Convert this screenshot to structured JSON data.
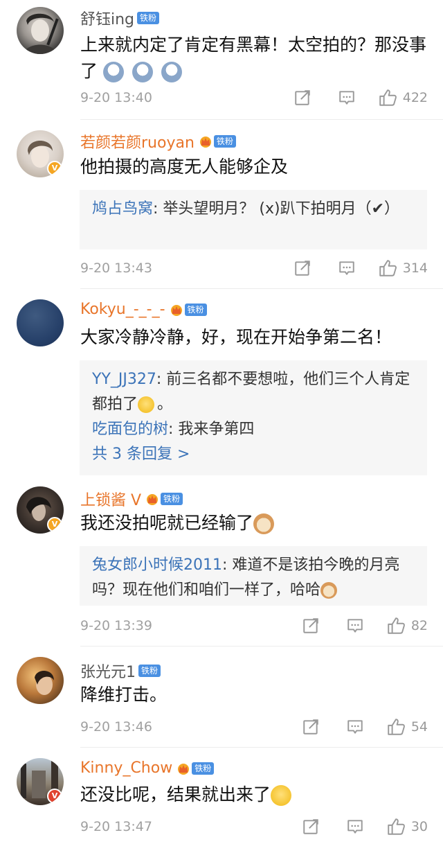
{
  "comments": [
    {
      "name": "舒钰ing",
      "badge": "铁粉",
      "text": "上来就内定了肯定有黑幕！太空拍的？那没事了",
      "time": "9-20 13:40",
      "likes": "422"
    },
    {
      "name": "若颜若颜ruoyan",
      "badge": "铁粉",
      "text": "他拍摄的高度无人能够企及",
      "reply_user": "鸠占鸟窝",
      "reply_text": "举头望明月？ (x)趴下拍明月（✔）",
      "time": "9-20 13:43",
      "likes": "314"
    },
    {
      "name": "Kokyu_-_-_-",
      "badge": "铁粉",
      "text": "大家冷静冷静，好，现在开始争第二名！",
      "reply1_user": "YY_JJ327",
      "reply1_text": "前三名都不要想啦，他们三个人肯定都拍了",
      "reply1_end": "。",
      "reply2_user": "吃面包的树",
      "reply2_text": "我来争第四",
      "more_replies": "共 3 条回复 >"
    },
    {
      "name": "上锁酱 V",
      "badge": "铁粉",
      "text": "我还没拍呢就已经输了",
      "reply_user": "兔女郎小时候2011",
      "reply_text": "难道不是该拍今晚的月亮吗？现在他们和咱们一样了，哈哈",
      "time": "9-20 13:39",
      "likes": "82"
    },
    {
      "name": "张光元1",
      "badge": "铁粉",
      "text": "降维打击。",
      "time": "9-20 13:46",
      "likes": "54"
    },
    {
      "name": "Kinny_Chow",
      "badge": "铁粉",
      "text": "还没比呢，结果就出来了",
      "time": "9-20 13:47",
      "likes": "30"
    }
  ],
  "colors": {
    "name_gray": "#555555",
    "name_vip": "#e8752a",
    "link_blue": "#3b73b8",
    "badge_blue": "#4a90e2",
    "meta_gray": "#a0a0a0",
    "reply_bg": "#f6f6f6"
  },
  "icons": [
    "share-icon",
    "comment-icon",
    "like-icon",
    "crown-icon",
    "verified-icon"
  ]
}
